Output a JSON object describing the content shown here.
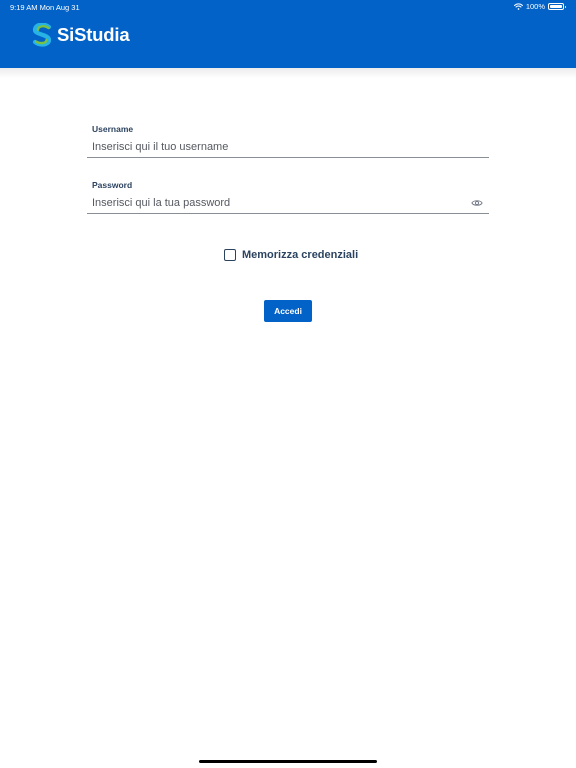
{
  "status_bar": {
    "time_date": "9:19 AM   Mon Aug 31",
    "battery": "100%",
    "battery_level": 1.0,
    "wifi_icon": "wifi-icon"
  },
  "header": {
    "app_name": "SiStudia",
    "logo_icon": "sistudia-s-logo",
    "background_color": "#0262c8"
  },
  "login_form": {
    "username": {
      "label": "Username",
      "placeholder": "Inserisci qui il tuo username",
      "value": ""
    },
    "password": {
      "label": "Password",
      "placeholder": "Inserisci qui la tua password",
      "value": "",
      "toggle_icon": "eye-icon"
    },
    "remember": {
      "label": "Memorizza credenziali",
      "checked": false
    },
    "submit_label": "Accedi"
  },
  "colors": {
    "accent": "#0262c8",
    "label_text": "#2c4360",
    "logo_green": "#7ac143",
    "logo_cyan": "#27b4e5"
  }
}
